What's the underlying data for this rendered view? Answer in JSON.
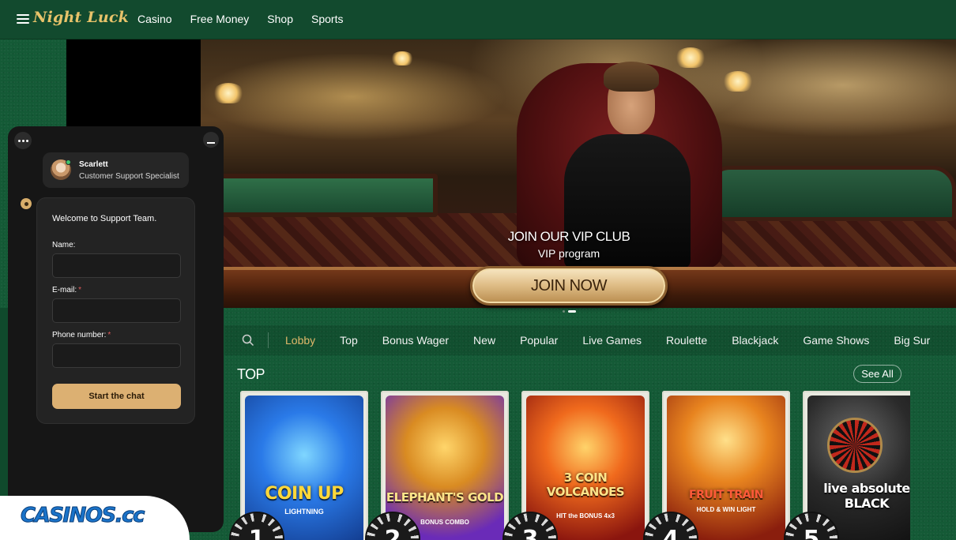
{
  "header": {
    "logo": "Night Luck",
    "nav": [
      "Casino",
      "Free Money",
      "Shop",
      "Sports"
    ]
  },
  "hero": {
    "title": "JOIN OUR VIP CLUB",
    "subtitle": "VIP program",
    "button": "JOIN NOW",
    "slide_count": 2,
    "active_slide": 2
  },
  "categories": {
    "items": [
      "Lobby",
      "Top",
      "Bonus Wager",
      "New",
      "Popular",
      "Live Games",
      "Roulette",
      "Blackjack",
      "Game Shows",
      "Big Sur"
    ],
    "active": "Lobby"
  },
  "top_section": {
    "title": "TOP",
    "see_all": "See All",
    "games": [
      {
        "name": "COIN UP",
        "sub": "LIGHTNING",
        "rank": "1",
        "colors": [
          "#1d6fe0",
          "#53b8ff"
        ]
      },
      {
        "name": "ELEPHANT'S GOLD",
        "sub": "BONUS COMBO",
        "rank": "2",
        "colors": [
          "#6a2bb8",
          "#f0b63a"
        ]
      },
      {
        "name": "3 COIN VOLCANOES",
        "sub": "HIT the BONUS 4x3",
        "rank": "3",
        "colors": [
          "#c0281c",
          "#f7c23b"
        ]
      },
      {
        "name": "FRUIT TRAIN",
        "sub": "HOLD & WIN LIGHT",
        "rank": "4",
        "colors": [
          "#b33617",
          "#f3b347"
        ]
      },
      {
        "name": "live absolute BLACK",
        "sub": "",
        "rank": "5",
        "colors": [
          "#2a2a2a",
          "#5a5a5a"
        ]
      }
    ]
  },
  "chat": {
    "agent_name": "Scarlett",
    "agent_role": "Customer Support Specialist",
    "welcome": "Welcome to Support Team.",
    "fields": [
      {
        "label": "Name:",
        "required": false,
        "value": ""
      },
      {
        "label": "E-mail:",
        "required": true,
        "value": ""
      },
      {
        "label": "Phone number:",
        "required": true,
        "value": ""
      }
    ],
    "start_button": "Start the chat"
  },
  "watermark": "CASINOS.cc",
  "colors": {
    "accent_gold": "#e0b86a",
    "felt_green": "#145a36",
    "chat_button": "#dcb072"
  }
}
